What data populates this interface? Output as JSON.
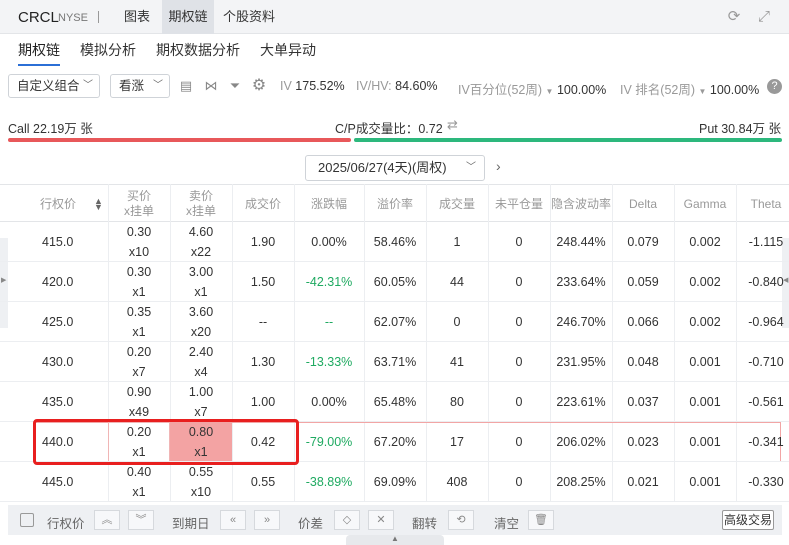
{
  "topbar": {
    "ticker": "CRCL",
    "exchange": "NYSE",
    "tabs": [
      {
        "label": "图表"
      },
      {
        "label": "期权链"
      },
      {
        "label": "个股资料"
      }
    ]
  },
  "subtabs": [
    {
      "label": "期权链"
    },
    {
      "label": "模拟分析"
    },
    {
      "label": "期权数据分析"
    },
    {
      "label": "大单异动"
    }
  ],
  "toolbar": {
    "combo_select": "自定义组合",
    "direction_select": "看涨",
    "iv_label": "IV",
    "iv_value": "175.52%",
    "ivhv_label": "IV/HV:",
    "ivhv_value": "84.60%",
    "iv_pct_label": "IV百分位(52周)",
    "iv_pct_value": "100.00%",
    "iv_rank_label": "IV 排名(52周)",
    "iv_rank_value": "100.00%"
  },
  "ratio": {
    "call": "Call 22.19万 张",
    "cp": "C/P成交量比：0.72",
    "put": "Put 30.84万 张",
    "call_color": "#e8585a",
    "put_color": "#2db87d"
  },
  "expiry": {
    "selected": "2025/06/27(4天)(周权)"
  },
  "columns": [
    {
      "label": "行权价"
    },
    {
      "label": "买价\nx挂单"
    },
    {
      "label": "卖价\nx挂单"
    },
    {
      "label": "成交价"
    },
    {
      "label": "涨跌幅"
    },
    {
      "label": "溢价率"
    },
    {
      "label": "成交量"
    },
    {
      "label": "未平仓量"
    },
    {
      "label": "隐含波动率"
    },
    {
      "label": "Delta"
    },
    {
      "label": "Gamma"
    },
    {
      "label": "Theta"
    }
  ],
  "rows": [
    {
      "strike": "415.0",
      "bid": "0.30\nx10",
      "ask": "4.60\nx22",
      "last": "1.90",
      "chg": "0.00%",
      "premium": "58.46%",
      "volume": "1",
      "oi": "0",
      "iv": "248.44%",
      "delta": "0.079",
      "gamma": "0.002",
      "theta": "-1.115"
    },
    {
      "strike": "420.0",
      "bid": "0.30\nx1",
      "ask": "3.00\nx1",
      "last": "1.50",
      "chg": "-42.31%",
      "premium": "60.05%",
      "volume": "44",
      "oi": "0",
      "iv": "233.64%",
      "delta": "0.059",
      "gamma": "0.002",
      "theta": "-0.840"
    },
    {
      "strike": "425.0",
      "bid": "0.35\nx1",
      "ask": "3.60\nx20",
      "last": "--",
      "chg": "--",
      "premium": "62.07%",
      "volume": "0",
      "oi": "0",
      "iv": "246.70%",
      "delta": "0.066",
      "gamma": "0.002",
      "theta": "-0.964"
    },
    {
      "strike": "430.0",
      "bid": "0.20\nx7",
      "ask": "2.40\nx4",
      "last": "1.30",
      "chg": "-13.33%",
      "premium": "63.71%",
      "volume": "41",
      "oi": "0",
      "iv": "231.95%",
      "delta": "0.048",
      "gamma": "0.001",
      "theta": "-0.710"
    },
    {
      "strike": "435.0",
      "bid": "0.90\nx49",
      "ask": "1.00\nx7",
      "last": "1.00",
      "chg": "0.00%",
      "premium": "65.48%",
      "volume": "80",
      "oi": "0",
      "iv": "223.61%",
      "delta": "0.037",
      "gamma": "0.001",
      "theta": "-0.561"
    },
    {
      "strike": "440.0",
      "bid": "0.20\nx1",
      "ask": "0.80\nx1",
      "last": "0.42",
      "chg": "-79.00%",
      "premium": "67.20%",
      "volume": "17",
      "oi": "0",
      "iv": "206.02%",
      "delta": "0.023",
      "gamma": "0.001",
      "theta": "-0.341"
    },
    {
      "strike": "445.0",
      "bid": "0.40\nx1",
      "ask": "0.55\nx10",
      "last": "0.55",
      "chg": "-38.89%",
      "premium": "69.09%",
      "volume": "408",
      "oi": "0",
      "iv": "208.25%",
      "delta": "0.021",
      "gamma": "0.001",
      "theta": "-0.330"
    }
  ],
  "bottom": {
    "strike_label": "行权价",
    "expiry_label": "到期日",
    "spread_label": "价差",
    "flip_label": "翻转",
    "clear_label": "清空",
    "advanced_label": "高级交易"
  }
}
